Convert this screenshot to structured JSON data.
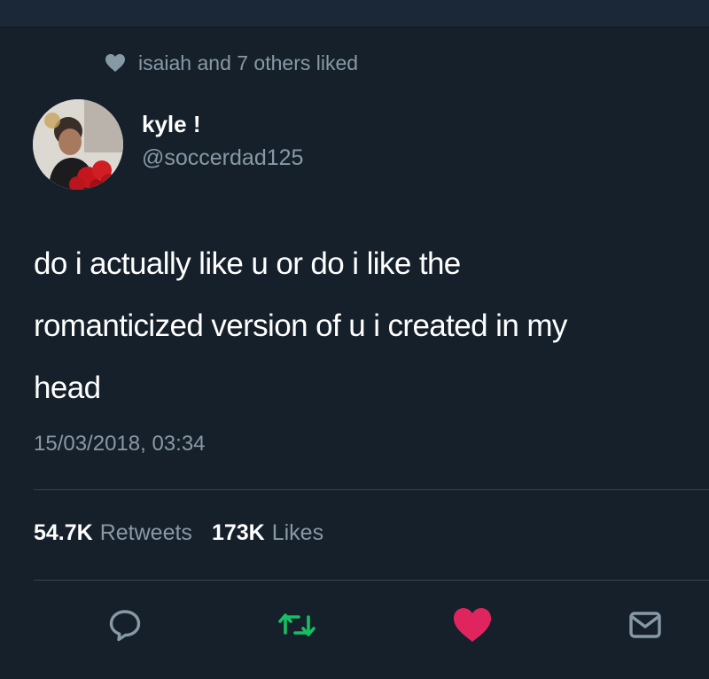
{
  "social_context": {
    "text": "isaiah and 7 others liked",
    "icon": "heart-icon"
  },
  "author": {
    "name": "kyle !",
    "handle": "@soccerdad125"
  },
  "tweet": {
    "lines": [
      "do i actually like u or do i like the",
      "romanticized version of u i created in my",
      "head"
    ],
    "timestamp": "15/03/2018, 03:34"
  },
  "stats": {
    "retweets_count": "54.7K",
    "retweets_label": "Retweets",
    "likes_count": "173K",
    "likes_label": "Likes"
  },
  "actions": [
    {
      "name": "reply",
      "icon": "comment-icon"
    },
    {
      "name": "retweet",
      "icon": "retweet-icon",
      "color": "#17bf63"
    },
    {
      "name": "like",
      "icon": "heart-icon",
      "color": "#e0245e",
      "active": true
    },
    {
      "name": "share",
      "icon": "envelope-icon"
    }
  ],
  "colors": {
    "background": "#15202b",
    "secondary_text": "#8899a6",
    "primary_text": "#ffffff",
    "like": "#e0245e",
    "retweet": "#17bf63"
  }
}
